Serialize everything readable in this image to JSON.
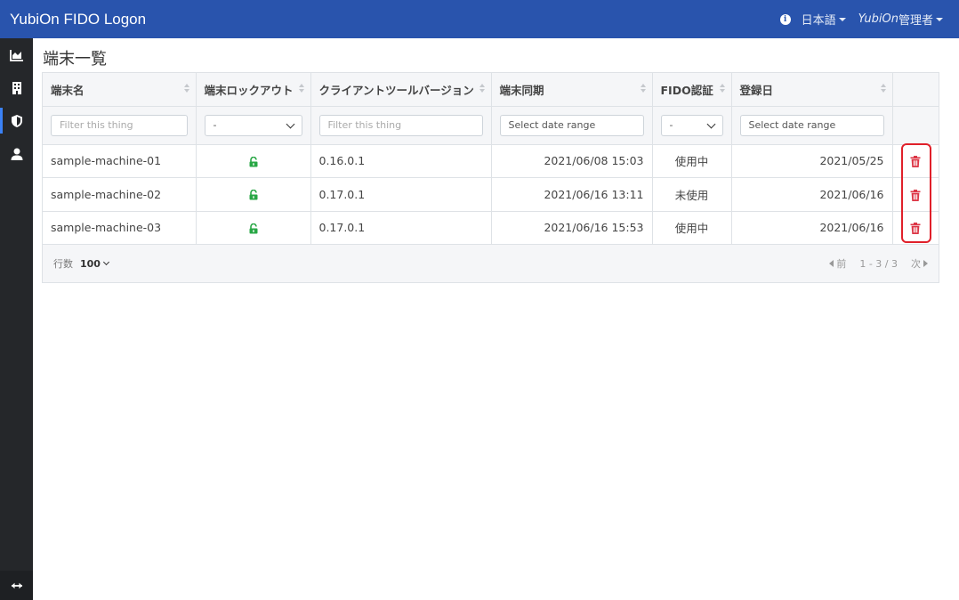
{
  "app": {
    "title": "YubiOn FIDO Logon"
  },
  "navbar": {
    "language_label": "日本語",
    "admin_italic": "YubiOn",
    "admin_suffix": "管理者"
  },
  "sidebar": {
    "items": [
      {
        "icon": "chart-area-icon"
      },
      {
        "icon": "building-icon"
      },
      {
        "icon": "shield-icon",
        "active": true
      },
      {
        "icon": "user-icon"
      }
    ],
    "bottom_icon": "expand-arrows-icon"
  },
  "page": {
    "title": "端末一覧"
  },
  "table": {
    "columns": [
      "端末名",
      "端末ロックアウト",
      "クライアントツールバージョン",
      "端末同期",
      "FIDO認証",
      "登録日"
    ],
    "filters": {
      "name_placeholder": "Filter this thing",
      "lockout_selected": "-",
      "version_placeholder": "Filter this thing",
      "sync_placeholder": "Select date range",
      "fido_selected": "-",
      "registered_placeholder": "Select date range"
    },
    "rows": [
      {
        "name": "sample-machine-01",
        "version": "0.16.0.1",
        "sync": "2021/06/08 15:03",
        "fido": "使用中",
        "registered": "2021/05/25"
      },
      {
        "name": "sample-machine-02",
        "version": "0.17.0.1",
        "sync": "2021/06/16 13:11",
        "fido": "未使用",
        "registered": "2021/06/16"
      },
      {
        "name": "sample-machine-03",
        "version": "0.17.0.1",
        "sync": "2021/06/16 15:53",
        "fido": "使用中",
        "registered": "2021/06/16"
      }
    ],
    "lock_color": "#28a745",
    "delete_color": "#dc3545"
  },
  "footer": {
    "rows_label": "行数",
    "rows_value": "100",
    "prev_label": "前",
    "range": "1 - 3 / 3",
    "next_label": "次"
  },
  "colors": {
    "navbar": "#2954ad",
    "sidebar": "#25272a",
    "highlight": "#e0202a"
  }
}
